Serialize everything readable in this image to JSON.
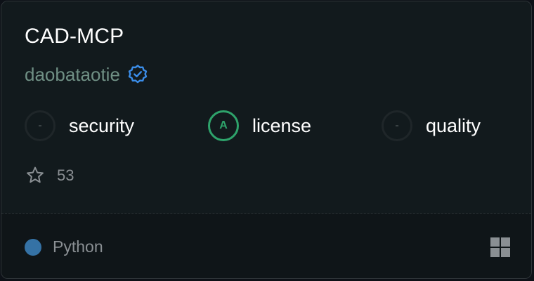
{
  "repo": {
    "title": "CAD-MCP",
    "owner": "daobataotie",
    "verified_icon": "verified-badge-icon",
    "stars": "53"
  },
  "scores": [
    {
      "label": "security",
      "grade": "-",
      "status": "none"
    },
    {
      "label": "license",
      "grade": "A",
      "status": "good"
    },
    {
      "label": "quality",
      "grade": "-",
      "status": "none"
    }
  ],
  "footer": {
    "language": "Python",
    "language_color": "#3572a5",
    "platform_icon": "windows-icon"
  },
  "colors": {
    "background": "#121a1d",
    "accent_good": "#2ea36b",
    "verified": "#3b8eea",
    "owner": "#6f8f84"
  }
}
